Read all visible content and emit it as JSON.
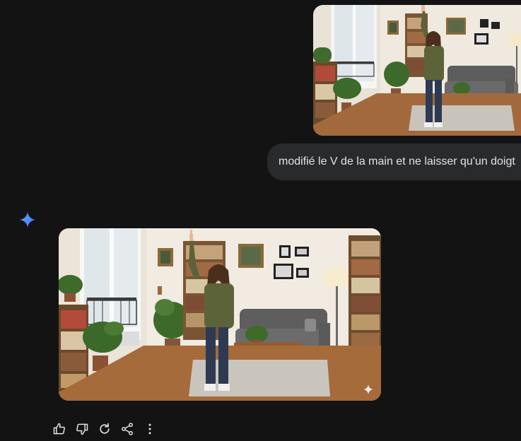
{
  "conversation": {
    "user_message": {
      "text": "modifié le V de la main et ne laisser qu'un doigt"
    },
    "assistant": {
      "icon": "gemini-spark-icon"
    }
  },
  "actions": [
    {
      "name": "thumbs-up-icon"
    },
    {
      "name": "thumbs-down-icon"
    },
    {
      "name": "regenerate-icon"
    },
    {
      "name": "share-icon"
    },
    {
      "name": "more-options-icon"
    }
  ],
  "colors": {
    "background": "#131314",
    "bubble": "#282a2c",
    "text": "#e3e3e3",
    "spark_blue": "#4c8df6"
  }
}
